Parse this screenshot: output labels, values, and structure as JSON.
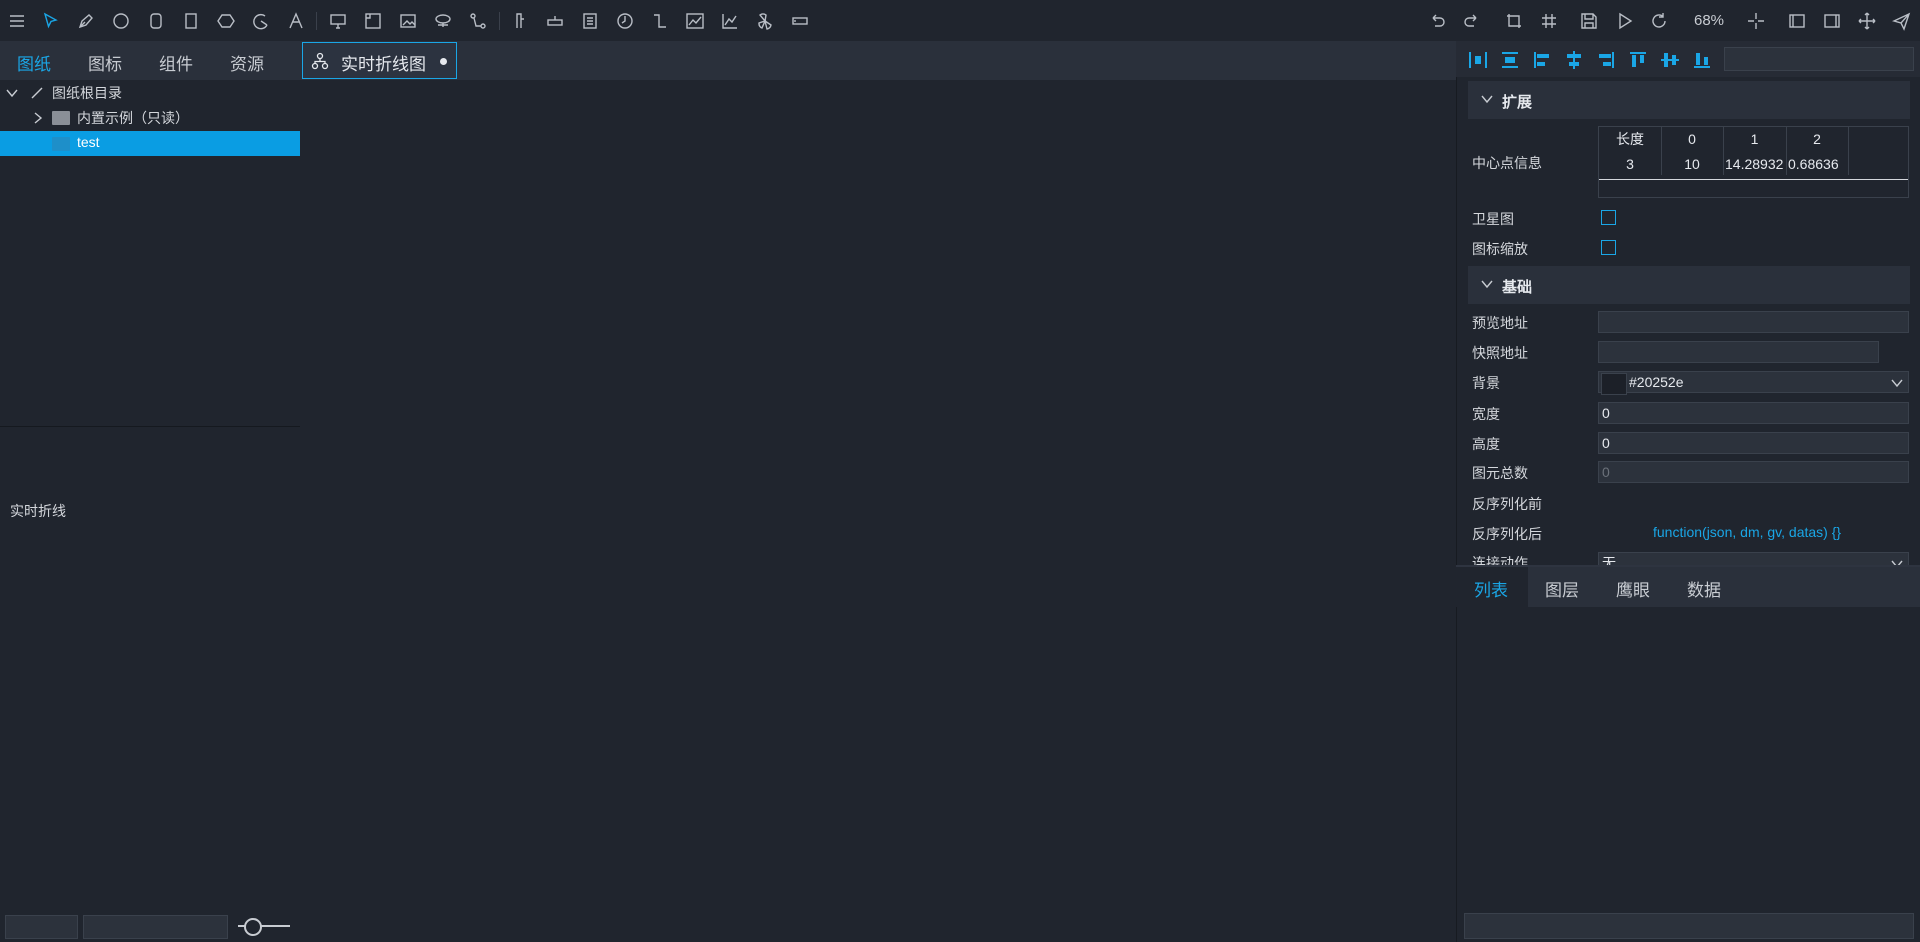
{
  "toolbar": {
    "left_icons": [
      "menu-icon",
      "select-icon",
      "pen-icon",
      "circle-icon",
      "rounded-rect-icon",
      "rect-icon",
      "hexagon-icon",
      "arc-icon",
      "text-icon",
      "monitor-icon",
      "frame-icon",
      "image-icon",
      "network-icon",
      "connector-icon",
      "chart-bar-v-icon",
      "chart-bar-h-icon",
      "document-icon",
      "clock-icon",
      "step-line-icon",
      "line-chart-icon",
      "area-chart-icon",
      "fan-icon",
      "input-box-icon"
    ],
    "right_icons": [
      "undo-icon",
      "redo-icon",
      "crop-icon",
      "grid-icon",
      "save-icon",
      "play-icon",
      "refresh-icon",
      "crosshair-icon",
      "panel-left-icon",
      "panel-right-icon",
      "move-icon",
      "send-icon"
    ],
    "zoom": "68%"
  },
  "left_tabs": [
    "图纸",
    "图标",
    "组件",
    "资源"
  ],
  "left_tab_active": 0,
  "tree": {
    "root": "图纸根目录",
    "builtin": "内置示例（只读）",
    "test": "test"
  },
  "component_label": "实时折线",
  "document_tab": {
    "label": "实时折线图"
  },
  "sections": {
    "extend": "扩展",
    "basic": "基础"
  },
  "center_info": {
    "label": "中心点信息",
    "headers": [
      "长度",
      "0",
      "1",
      "2"
    ],
    "values": [
      "3",
      "10",
      "14.28932",
      "0.68636"
    ]
  },
  "props": {
    "satellite": "卫星图",
    "icon_scale": "图标缩放",
    "preview_url": "预览地址",
    "snapshot_url": "快照地址",
    "background": "背景",
    "background_value": "#20252e",
    "width": "宽度",
    "width_value": "0",
    "height": "高度",
    "height_value": "0",
    "element_total": "图元总数",
    "element_total_value": "0",
    "deserialize_before": "反序列化前",
    "deserialize_after": "反序列化后",
    "deserialize_after_value": "function(json, dm, gv, datas) {}",
    "connect_action": "连接动作",
    "connect_action_value": "无"
  },
  "right_tabs": [
    "列表",
    "图层",
    "鹰眼",
    "数据"
  ],
  "right_tab_active": 0,
  "colors": {
    "accent": "#1aa6e6",
    "background": "#20252e",
    "panel": "#2a303b"
  }
}
